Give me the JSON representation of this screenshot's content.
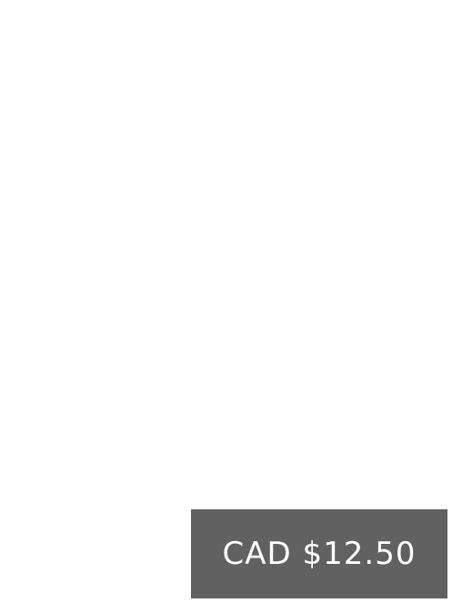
{
  "price": {
    "label": "CAD $12.50",
    "background_color": "#616161",
    "text_color": "#ffffff"
  }
}
